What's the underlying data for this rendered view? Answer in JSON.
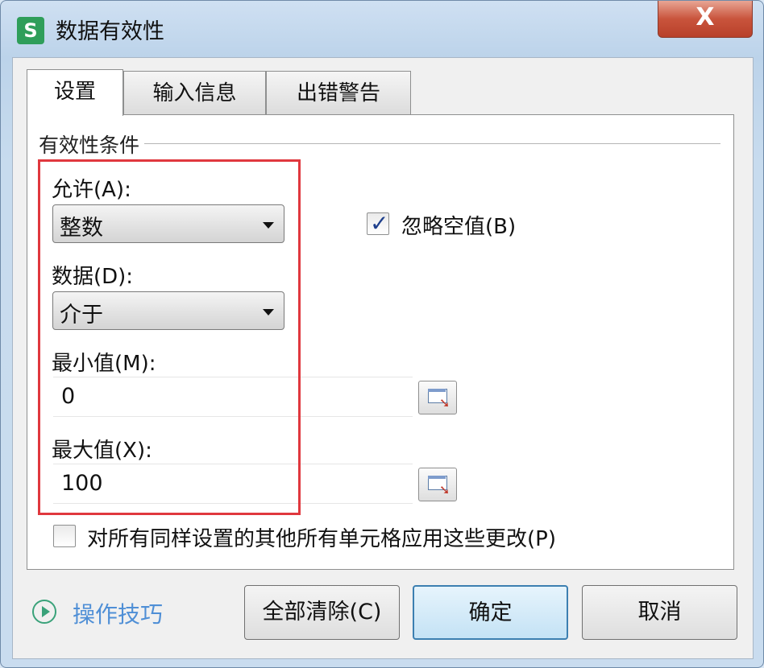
{
  "window": {
    "title": "数据有效性",
    "app_icon": "S",
    "close_label": "X"
  },
  "tabs": [
    {
      "label": "设置",
      "active": true
    },
    {
      "label": "输入信息",
      "active": false
    },
    {
      "label": "出错警告",
      "active": false
    }
  ],
  "group": {
    "label": "有效性条件"
  },
  "allow": {
    "label": "允许(A):",
    "value": "整数"
  },
  "data": {
    "label": "数据(D):",
    "value": "介于"
  },
  "min": {
    "label": "最小值(M):",
    "value": "0"
  },
  "max": {
    "label": "最大值(X):",
    "value": "100"
  },
  "ignore_blank": {
    "label": "忽略空值(B)",
    "checked": true
  },
  "apply_all": {
    "label": "对所有同样设置的其他所有单元格应用这些更改(P)",
    "checked": false
  },
  "footer": {
    "tips_label": "操作技巧",
    "clear_label": "全部清除(C)",
    "ok_label": "确定",
    "cancel_label": "取消"
  },
  "colors": {
    "highlight": "#e0383e",
    "link": "#4f8fd6",
    "app_icon": "#2f9e5a"
  }
}
